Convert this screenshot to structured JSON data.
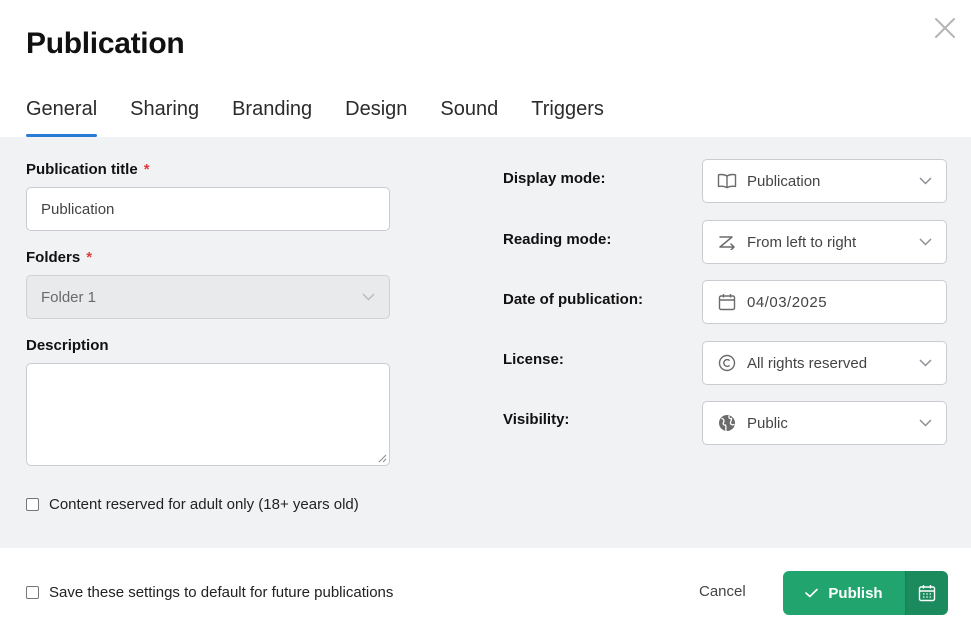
{
  "dialog": {
    "title": "Publication",
    "tabs": [
      {
        "label": "General",
        "active": true
      },
      {
        "label": "Sharing",
        "active": false
      },
      {
        "label": "Branding",
        "active": false
      },
      {
        "label": "Design",
        "active": false
      },
      {
        "label": "Sound",
        "active": false
      },
      {
        "label": "Triggers",
        "active": false
      }
    ]
  },
  "form": {
    "publication_title": {
      "label": "Publication title",
      "required_mark": "*",
      "value": "Publication"
    },
    "folders": {
      "label": "Folders",
      "required_mark": "*",
      "value": "Folder 1"
    },
    "description": {
      "label": "Description",
      "value": ""
    },
    "adult_only": {
      "label": "Content reserved for adult only (18+ years old)",
      "checked": false
    }
  },
  "settings": {
    "display_mode": {
      "label": "Display mode:",
      "value": "Publication",
      "icon": "book-open-icon"
    },
    "reading_mode": {
      "label": "Reading mode:",
      "value": "From left to right",
      "icon": "z-arrow-icon"
    },
    "date_of_publication": {
      "label": "Date of publication:",
      "value": "04/03/2025",
      "icon": "calendar-icon"
    },
    "license": {
      "label": "License:",
      "value": "All rights reserved",
      "icon": "copyright-icon"
    },
    "visibility": {
      "label": "Visibility:",
      "value": "Public",
      "icon": "globe-icon"
    }
  },
  "footer": {
    "save_default": {
      "label": "Save these settings to default for future publications",
      "checked": false
    },
    "cancel_label": "Cancel",
    "publish_label": "Publish"
  },
  "colors": {
    "accent_tab": "#2a7bd3",
    "publish": "#22a46f",
    "publish_dark": "#1b8a5c",
    "required": "#e03c3c",
    "panel_bg": "#f1f2f4"
  }
}
